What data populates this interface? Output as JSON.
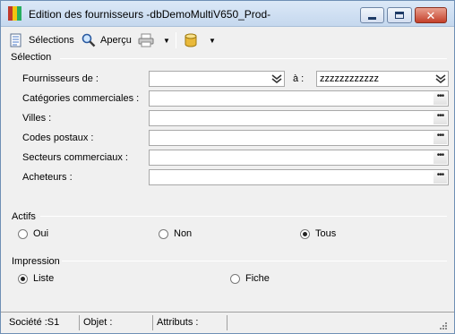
{
  "window": {
    "title": "Edition des fournisseurs -dbDemoMultiV650_Prod-",
    "colors": {
      "frame": "#6f8fb5",
      "close": "#c4402a"
    }
  },
  "toolbar": {
    "selections_label": "Sélections",
    "apercu_label": "Aperçu"
  },
  "selection": {
    "header": "Sélection",
    "rows": [
      {
        "label": "Fournisseurs de :",
        "value": "",
        "to_label": "à :",
        "to_value": "zzzzzzzzzzzz"
      },
      {
        "label": "Catégories commerciales :",
        "value": ""
      },
      {
        "label": "Villes :",
        "value": ""
      },
      {
        "label": "Codes postaux :",
        "value": ""
      },
      {
        "label": "Secteurs commerciaux :",
        "value": ""
      },
      {
        "label": "Acheteurs :",
        "value": ""
      }
    ]
  },
  "actifs": {
    "header": "Actifs",
    "options": [
      {
        "label": "Oui",
        "checked": false
      },
      {
        "label": "Non",
        "checked": false
      },
      {
        "label": "Tous",
        "checked": true
      }
    ]
  },
  "impression": {
    "header": "Impression",
    "options": [
      {
        "label": "Liste",
        "checked": true
      },
      {
        "label": "Fiche",
        "checked": false
      }
    ]
  },
  "status": {
    "societe": "Société :S1",
    "objet": "Objet :",
    "attributs": "Attributs :"
  }
}
